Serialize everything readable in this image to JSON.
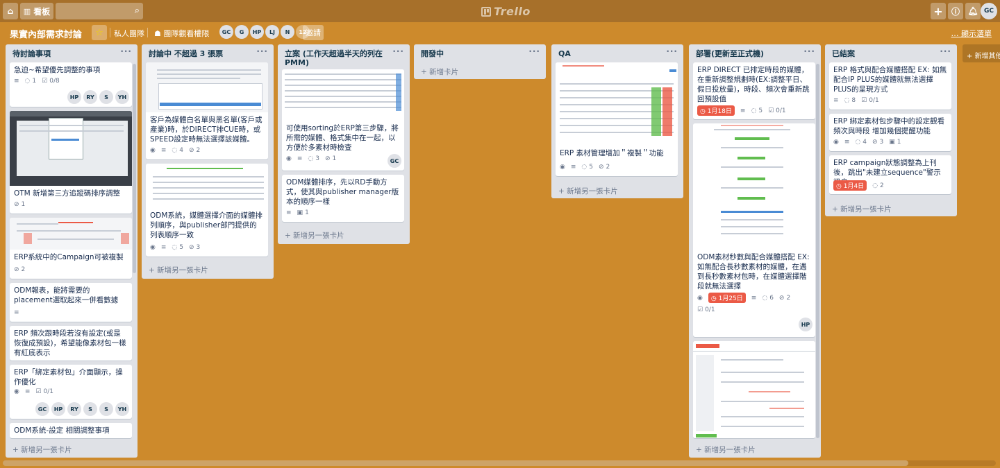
{
  "topbar": {
    "boards_label": "看板",
    "search_placeholder": "",
    "logo_text": "Trello",
    "user_initials": "GC"
  },
  "board": {
    "title": "果實內部需求討論",
    "team_label": "私人團隊",
    "visibility_label": "團隊觀看權限",
    "members": [
      "GC",
      "G",
      "HP",
      "LJ",
      "N"
    ],
    "member_count": "12",
    "invite_label": "邀請",
    "show_menu_label": "顯示選單"
  },
  "add_list_label": "+ 新增其他",
  "lists": [
    {
      "title": "待討論事項",
      "add_card_label": "新增另一張卡片",
      "cards": [
        {
          "title": "急迫~希望優先調整的事項",
          "comments": "1",
          "checklist": "0/8",
          "members": [
            "HP",
            "RY",
            "S",
            "YH"
          ]
        },
        {
          "title": "OTM 新增第三方追蹤碼排序調整",
          "attachments": "1"
        },
        {
          "title": "ERP系統中的Campaign可被複製",
          "attachments": "2"
        },
        {
          "title": "ODM報表，能將需要的placement選取起來一併看數據"
        },
        {
          "title": "ERP 頻次跟時段若沒有設定(或是恢復成預設)，希望能像素材包一樣 有紅底表示"
        },
        {
          "title": "ERP「綁定素材包」介面顯示，操作優化",
          "checklist": "0/1",
          "members": [
            "GC",
            "HP",
            "RY",
            "S",
            "S",
            "YH"
          ]
        },
        {
          "title": "ODM系統-設定 相關調整事項"
        }
      ]
    },
    {
      "title": "討論中 不超過 3 張票",
      "add_card_label": "新增另一張卡片",
      "cards": [
        {
          "title": "客戶為媒體白名單與黑名單(客戶或產業)時，於DIRECT排CUE時，或SPEED設定時無法選擇該媒體。",
          "comments": "4",
          "attachments": "2"
        },
        {
          "title": "ODM系統，媒體選擇介面的媒體排列順序，與publisher部門提供的列表順序一致",
          "comments": "5",
          "attachments": "3"
        }
      ]
    },
    {
      "title": "立案 (工作天超過半天的列在PMM)",
      "add_card_label": "新增另一張卡片",
      "cards": [
        {
          "title": "可使用sorting於ERP第三步驟，將所需的媒體、格式集中在一起，以方便於多素材時檢查",
          "comments": "3",
          "attachments": "1",
          "members": [
            "GC"
          ]
        },
        {
          "title": "ODM媒體排序，先以RD手動方式，使其與publisher manager版本的順序一樣",
          "trello_cards": "1"
        }
      ]
    },
    {
      "title": "開發中",
      "add_card_label": "新增卡片",
      "cards": []
    },
    {
      "title": "QA",
      "add_card_label": "新增另一張卡片",
      "cards": [
        {
          "title": "ERP 素材管理增加＂複製＂功能",
          "comments": "5",
          "attachments": "2"
        }
      ]
    },
    {
      "title": "部署(更新至正式機)",
      "add_card_label": "新增另一張卡片",
      "cards": [
        {
          "title": "ERP DIRECT 已排定時段的媒體，在重新調整規劃時(EX:調整平日、假日投放量)，時段、頻次會重新跳回預設值",
          "due": "1月18日",
          "comments": "5",
          "checklist": "0/1"
        },
        {
          "title": "ODM素材秒數與配合媒體搭配 EX: 如無配合長秒數素材的媒體，在遇到長秒數素材包時，在媒體選擇階段就無法選擇",
          "due": "1月25日",
          "comments": "6",
          "attachments": "2",
          "checklist": "0/1",
          "members": [
            "HP"
          ]
        }
      ]
    },
    {
      "title": "已結案",
      "add_card_label": "新增另一張卡片",
      "cards": [
        {
          "title": "ERP 格式與配合媒體搭配 EX: 如無配合IP PLUS的媒體就無法選擇PLUS的呈現方式",
          "comments": "8",
          "checklist": "0/1"
        },
        {
          "title": "ERP 綁定素材包步驟中的設定觀看頻次與時段 增加幾個提醒功能",
          "comments": "4",
          "attachments": "3",
          "trello_cards": "1"
        },
        {
          "title": "ERP campaign狀態調整為上刊後，跳出\"未建立sequence\"警示訊息",
          "due": "1月4日",
          "comments": "2"
        }
      ]
    }
  ],
  "colors": {
    "background": "#cd8a2c",
    "header": "#a7702a",
    "list": "#dfe1e6",
    "due_overdue": "#eb5a46"
  }
}
